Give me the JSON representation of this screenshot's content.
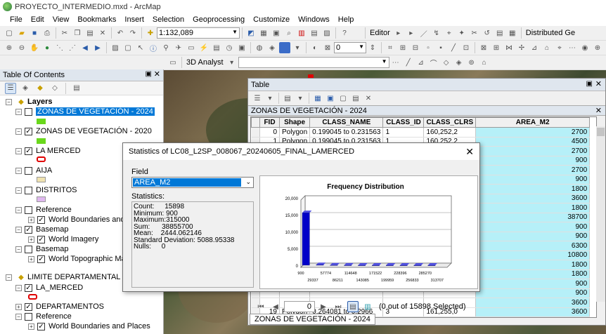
{
  "window": {
    "title": "PROYECTO_INTERMEDIO.mxd - ArcMap"
  },
  "menu": [
    "File",
    "Edit",
    "View",
    "Bookmarks",
    "Insert",
    "Selection",
    "Geoprocessing",
    "Customize",
    "Windows",
    "Help"
  ],
  "toolbar": {
    "scale": "1:132,089",
    "editor": "Editor",
    "distributed": "Distributed Ge",
    "zero_value": "0",
    "analyst": "3D Analyst"
  },
  "toc": {
    "title": "Table Of Contents",
    "items": [
      {
        "label": "Layers"
      },
      {
        "label": "ZONAS DE VEGETACIÓN - 2024"
      },
      {
        "label": "ZONAS DE VEGETACIÓN - 2020"
      },
      {
        "label": "LA MERCED"
      },
      {
        "label": "AIJA"
      },
      {
        "label": "DISTRITOS"
      },
      {
        "label": "Reference"
      },
      {
        "label": "World Boundaries and Pl"
      },
      {
        "label": "Basemap"
      },
      {
        "label": "World Imagery"
      },
      {
        "label": "Basemap"
      },
      {
        "label": "World Topographic Map"
      },
      {
        "label": "LIMITE DEPARTAMENTAL"
      },
      {
        "label": "LA_MERCED"
      },
      {
        "label": "DEPARTAMENTOS"
      },
      {
        "label": "Reference"
      },
      {
        "label": "World Boundaries and Places"
      }
    ],
    "colors": {
      "green": "#6ad81c",
      "red": "#e00000",
      "beige": "#f0e2b0",
      "lilac": "#e0b8f0"
    }
  },
  "table": {
    "title": "Table",
    "layer": "ZONAS DE VEGETACIÓN - 2024",
    "columns": [
      "FID",
      "Shape",
      "CLASS_NAME",
      "CLASS_ID",
      "CLASS_CLRS",
      "AREA_M2"
    ],
    "rows": [
      {
        "fid": "0",
        "shape": "Polygon",
        "cname": "0.199045 to 0.231563",
        "cid": "1",
        "clrs": "160,252,2",
        "area": "2700"
      },
      {
        "fid": "1",
        "shape": "Polygon",
        "cname": "0.199045 to 0.231563",
        "cid": "1",
        "clrs": "160,252,2",
        "area": "4500"
      }
    ],
    "area_values": [
      "2700",
      "4500",
      "2700",
      "900",
      "2700",
      "900",
      "1800",
      "3600",
      "1800",
      "38700",
      "900",
      "900",
      "6300",
      "10800",
      "1800",
      "1800",
      "900",
      "900",
      "3600"
    ],
    "row19": {
      "fid": "19",
      "shape": "Polygon",
      "cname": "0.264081 to 0.2966",
      "cid": "3",
      "clrs": "161,255,0"
    },
    "record_box": "0",
    "selection_status": "(0 out of 15898 Selected)",
    "tab_label": "ZONAS DE VEGETACIÓN - 2024"
  },
  "stats": {
    "title": "Statistics of LC08_L2SP_008067_20240605_FINAL_LAMERCED",
    "field_label": "Field",
    "field_value": "AREA_M2",
    "statistics_label": "Statistics:",
    "lines": [
      {
        "k": "Count:",
        "v": "15898"
      },
      {
        "k": "Minimum:",
        "v": "900"
      },
      {
        "k": "Maximum:",
        "v": "315000"
      },
      {
        "k": "Sum:",
        "v": "38855700"
      },
      {
        "k": "Mean:",
        "v": "2444.062146"
      },
      {
        "k": "Standard Deviation:",
        "v": "5088.95338"
      },
      {
        "k": "Nulls:",
        "v": "0"
      }
    ]
  },
  "chart_data": {
    "type": "bar",
    "title": "Frequency Distribution",
    "ylim": [
      0,
      20000
    ],
    "y_ticks": [
      "20,000",
      "15,000",
      "10,000",
      "5,000",
      "0"
    ],
    "x_ticks_top": [
      "900",
      "57774",
      "114648",
      "171522",
      "228396",
      "285270"
    ],
    "x_ticks_bottom": [
      "29337",
      "86211",
      "143085",
      "199959",
      "256833",
      "313707"
    ],
    "values": [
      15600,
      150,
      40,
      15,
      5,
      3,
      2,
      2,
      1,
      1
    ],
    "colors": {
      "bar": "#0000c8"
    }
  }
}
